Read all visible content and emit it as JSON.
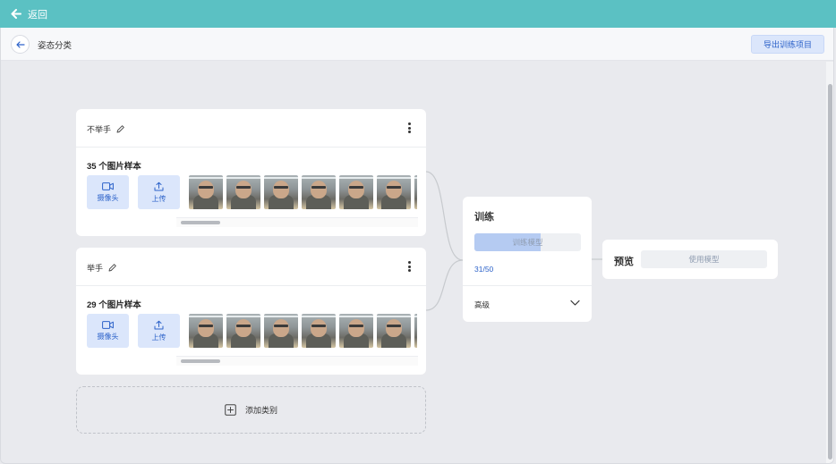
{
  "topbar": {
    "back_label": "返回",
    "color": "#5bc1c3"
  },
  "header": {
    "title": "姿态分类",
    "export_label": "导出训练项目"
  },
  "classes": [
    {
      "name": "不举手",
      "count_label": "35 个图片样本",
      "webcam_label": "摄像头",
      "upload_label": "上传"
    },
    {
      "name": "举手",
      "count_label": "29 个图片样本",
      "webcam_label": "摄像头",
      "upload_label": "上传"
    }
  ],
  "add_class_label": "添加类别",
  "training": {
    "title": "训练",
    "button_label": "训练模型",
    "progress_text": "31/50",
    "progress": 0.62,
    "advanced_label": "高级"
  },
  "preview": {
    "title": "预览",
    "use_model_label": "使用模型"
  },
  "colors": {
    "accent": "#2c62c9",
    "button_bg": "#dbe6fb",
    "progress_fill": "#b5cbf2"
  },
  "icons": [
    "arrow-left-icon",
    "pencil-icon",
    "more-vertical-icon",
    "video-camera-icon",
    "upload-icon",
    "plus-square-icon",
    "chevron-down-icon"
  ]
}
